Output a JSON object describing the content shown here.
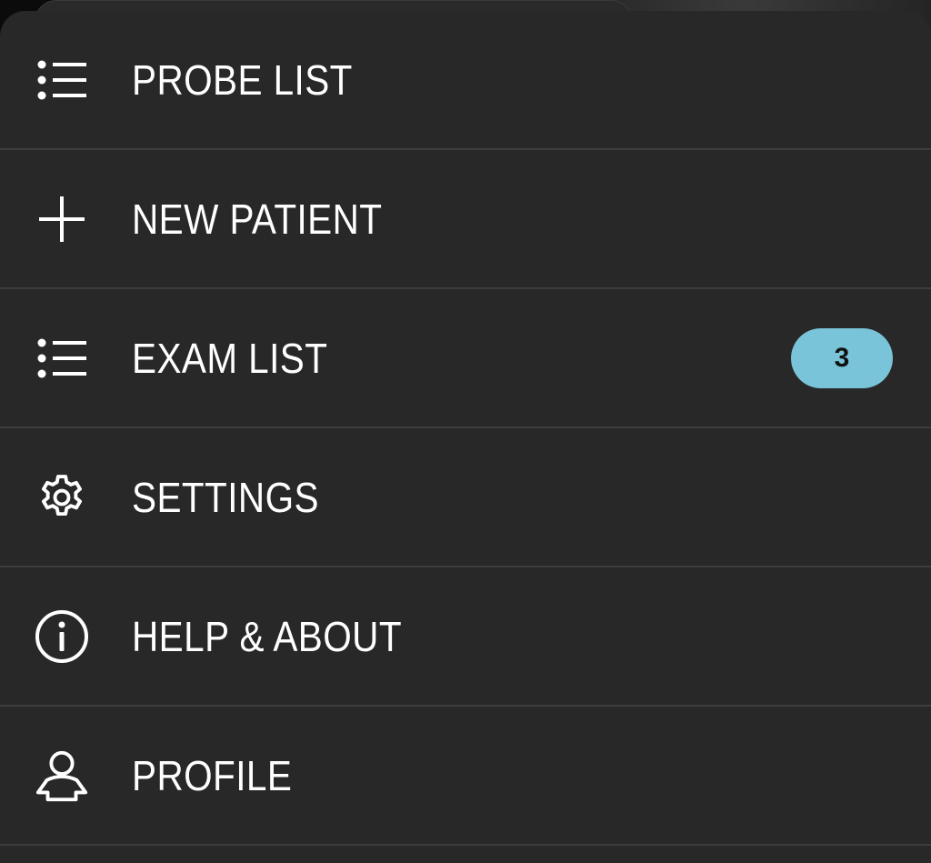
{
  "menu": {
    "items": [
      {
        "label": "PROBE LIST",
        "icon": "list-icon"
      },
      {
        "label": "NEW PATIENT",
        "icon": "plus-icon"
      },
      {
        "label": "EXAM LIST",
        "icon": "list-icon",
        "badge": "3"
      },
      {
        "label": "SETTINGS",
        "icon": "gear-icon"
      },
      {
        "label": "HELP & ABOUT",
        "icon": "info-icon"
      },
      {
        "label": "PROFILE",
        "icon": "user-icon"
      }
    ]
  },
  "colors": {
    "background": "#282828",
    "divider": "#3d3d3d",
    "text": "#ffffff",
    "badge": "#7ac4d9"
  }
}
